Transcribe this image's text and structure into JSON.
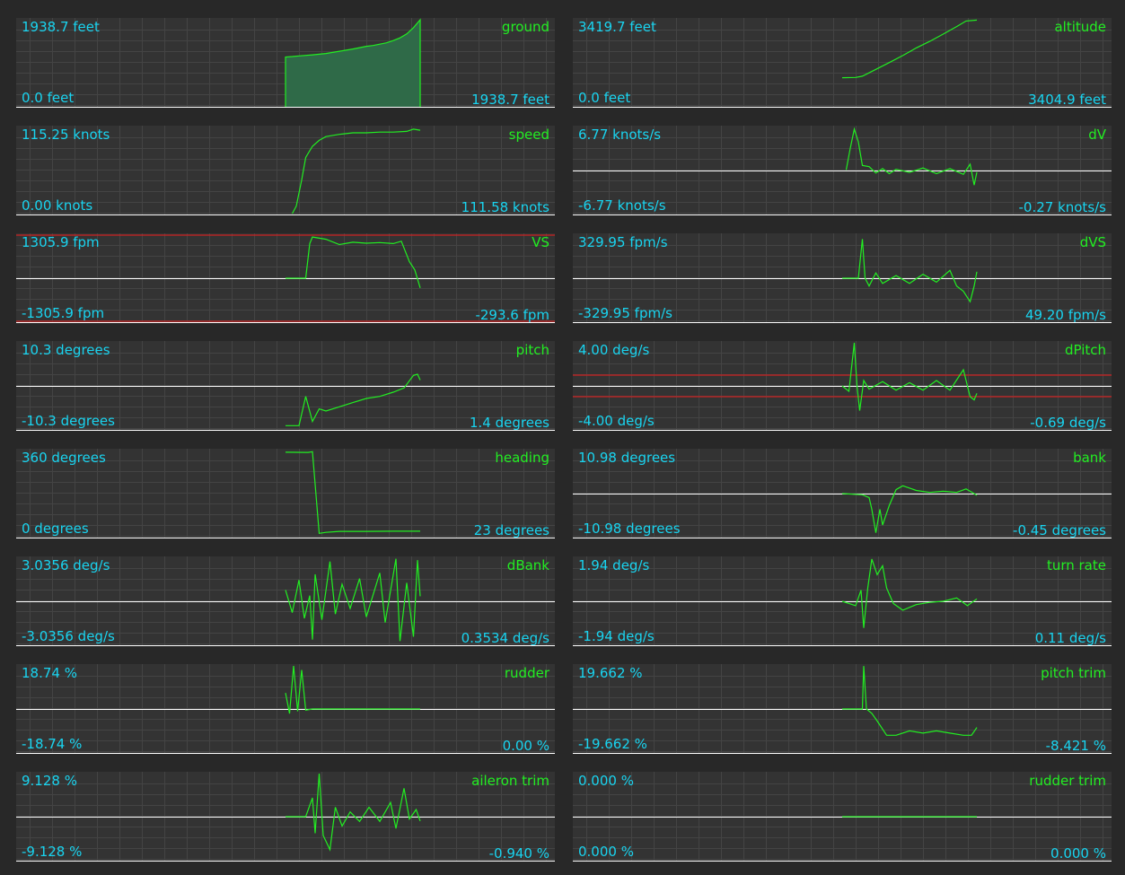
{
  "colors": {
    "grid": "#444444",
    "trace": "#22ee22",
    "value_text": "#19d4f0",
    "name_text": "#22ee22",
    "limit_line": "#cc2222",
    "axis": "#ffffff"
  },
  "panels": [
    {
      "id": "ground",
      "name": "ground",
      "max_label": "1938.7 feet",
      "min_label": "0.0 feet",
      "current_label": "1938.7 feet",
      "style": "area",
      "y_range": [
        0,
        1938.7
      ],
      "zero_line": false,
      "limit_lines": [],
      "trace": [
        [
          0,
          1100
        ],
        [
          0.05,
          1110
        ],
        [
          0.1,
          1125
        ],
        [
          0.2,
          1150
        ],
        [
          0.3,
          1180
        ],
        [
          0.4,
          1230
        ],
        [
          0.5,
          1280
        ],
        [
          0.55,
          1310
        ],
        [
          0.6,
          1340
        ],
        [
          0.65,
          1360
        ],
        [
          0.7,
          1390
        ],
        [
          0.75,
          1420
        ],
        [
          0.8,
          1470
        ],
        [
          0.85,
          1530
        ],
        [
          0.9,
          1620
        ],
        [
          0.95,
          1760
        ],
        [
          1,
          1938.7
        ]
      ]
    },
    {
      "id": "altitude",
      "name": "altitude",
      "max_label": "3419.7 feet",
      "min_label": "0.0 feet",
      "current_label": "3404.9 feet",
      "style": "line",
      "y_range": [
        0,
        3419.7
      ],
      "zero_line": false,
      "limit_lines": [],
      "trace": [
        [
          0,
          1120
        ],
        [
          0.1,
          1130
        ],
        [
          0.15,
          1180
        ],
        [
          0.25,
          1450
        ],
        [
          0.35,
          1720
        ],
        [
          0.45,
          2000
        ],
        [
          0.55,
          2300
        ],
        [
          0.65,
          2560
        ],
        [
          0.75,
          2850
        ],
        [
          0.85,
          3150
        ],
        [
          0.92,
          3370
        ],
        [
          1,
          3404.9
        ]
      ]
    },
    {
      "id": "speed",
      "name": "speed",
      "max_label": "115.25 knots",
      "min_label": "0.00 knots",
      "current_label": "111.58 knots",
      "style": "line",
      "y_range": [
        0,
        115.25
      ],
      "zero_line": false,
      "limit_lines": [],
      "trace": [
        [
          0.05,
          0
        ],
        [
          0.08,
          10
        ],
        [
          0.12,
          45
        ],
        [
          0.15,
          75
        ],
        [
          0.2,
          90
        ],
        [
          0.25,
          98
        ],
        [
          0.3,
          103
        ],
        [
          0.4,
          106
        ],
        [
          0.5,
          108
        ],
        [
          0.6,
          108
        ],
        [
          0.7,
          109
        ],
        [
          0.8,
          109
        ],
        [
          0.9,
          110
        ],
        [
          0.95,
          113
        ],
        [
          1,
          111.58
        ]
      ]
    },
    {
      "id": "dv",
      "name": "dV",
      "max_label": "6.77 knots/s",
      "min_label": "-6.77 knots/s",
      "current_label": "-0.27 knots/s",
      "style": "line",
      "y_range": [
        -6.77,
        6.77
      ],
      "zero_line": true,
      "limit_lines": [],
      "trace": [
        [
          0.03,
          0.1
        ],
        [
          0.06,
          3.5
        ],
        [
          0.09,
          6.5
        ],
        [
          0.12,
          4.5
        ],
        [
          0.15,
          0.8
        ],
        [
          0.2,
          0.6
        ],
        [
          0.25,
          -0.4
        ],
        [
          0.3,
          0.3
        ],
        [
          0.35,
          -0.5
        ],
        [
          0.4,
          0.2
        ],
        [
          0.5,
          -0.3
        ],
        [
          0.6,
          0.4
        ],
        [
          0.7,
          -0.5
        ],
        [
          0.8,
          0.3
        ],
        [
          0.9,
          -0.6
        ],
        [
          0.95,
          1.0
        ],
        [
          0.98,
          -2.3
        ],
        [
          1,
          -0.27
        ]
      ]
    },
    {
      "id": "vs",
      "name": "VS",
      "max_label": "1305.9 fpm",
      "min_label": "-1305.9 fpm",
      "current_label": "-293.6 fpm",
      "style": "line",
      "y_range": [
        -1305.9,
        1305.9
      ],
      "zero_line": true,
      "limit_lines": [
        1305.9,
        -1305.9
      ],
      "trace": [
        [
          0,
          0
        ],
        [
          0.15,
          0
        ],
        [
          0.18,
          1050
        ],
        [
          0.2,
          1250
        ],
        [
          0.3,
          1180
        ],
        [
          0.4,
          1020
        ],
        [
          0.5,
          1090
        ],
        [
          0.6,
          1060
        ],
        [
          0.7,
          1080
        ],
        [
          0.8,
          1050
        ],
        [
          0.86,
          1120
        ],
        [
          0.92,
          500
        ],
        [
          0.96,
          250
        ],
        [
          1,
          -293.6
        ]
      ]
    },
    {
      "id": "dvs",
      "name": "dVS",
      "max_label": "329.95 fpm/s",
      "min_label": "-329.95 fpm/s",
      "current_label": "49.20 fpm/s",
      "style": "line",
      "y_range": [
        -329.95,
        329.95
      ],
      "zero_line": true,
      "limit_lines": [],
      "trace": [
        [
          0,
          0
        ],
        [
          0.12,
          0
        ],
        [
          0.15,
          300
        ],
        [
          0.17,
          0
        ],
        [
          0.2,
          -60
        ],
        [
          0.25,
          40
        ],
        [
          0.3,
          -40
        ],
        [
          0.4,
          20
        ],
        [
          0.5,
          -40
        ],
        [
          0.6,
          30
        ],
        [
          0.7,
          -30
        ],
        [
          0.8,
          60
        ],
        [
          0.85,
          -60
        ],
        [
          0.9,
          -100
        ],
        [
          0.95,
          -180
        ],
        [
          0.98,
          -60
        ],
        [
          1,
          49.2
        ]
      ]
    },
    {
      "id": "pitch",
      "name": "pitch",
      "max_label": "10.3 degrees",
      "min_label": "-10.3 degrees",
      "current_label": "1.4 degrees",
      "style": "line",
      "y_range": [
        -10.3,
        10.3
      ],
      "zero_line": true,
      "limit_lines": [],
      "trace": [
        [
          0,
          -9.5
        ],
        [
          0.1,
          -9.5
        ],
        [
          0.15,
          -2.5
        ],
        [
          0.2,
          -8.5
        ],
        [
          0.25,
          -5.5
        ],
        [
          0.3,
          -6
        ],
        [
          0.4,
          -5
        ],
        [
          0.5,
          -4
        ],
        [
          0.6,
          -3
        ],
        [
          0.7,
          -2.5
        ],
        [
          0.8,
          -1.5
        ],
        [
          0.88,
          -0.5
        ],
        [
          0.95,
          2.5
        ],
        [
          0.98,
          2.8
        ],
        [
          1,
          1.4
        ]
      ]
    },
    {
      "id": "dpitch",
      "name": "dPitch",
      "max_label": "4.00 deg/s",
      "min_label": "-4.00 deg/s",
      "current_label": "-0.69 deg/s",
      "style": "line",
      "y_range": [
        -4.0,
        4.0
      ],
      "zero_line": true,
      "limit_lines": [
        1.0,
        -1.0
      ],
      "trace": [
        [
          0,
          0
        ],
        [
          0.05,
          -0.5
        ],
        [
          0.09,
          4.0
        ],
        [
          0.11,
          0
        ],
        [
          0.13,
          -2.3
        ],
        [
          0.16,
          0.5
        ],
        [
          0.2,
          -0.3
        ],
        [
          0.3,
          0.4
        ],
        [
          0.4,
          -0.4
        ],
        [
          0.5,
          0.3
        ],
        [
          0.6,
          -0.4
        ],
        [
          0.7,
          0.5
        ],
        [
          0.8,
          -0.4
        ],
        [
          0.9,
          1.5
        ],
        [
          0.95,
          -1.0
        ],
        [
          0.98,
          -1.3
        ],
        [
          1,
          -0.69
        ]
      ]
    },
    {
      "id": "heading",
      "name": "heading",
      "max_label": "360 degrees",
      "min_label": "0 degrees",
      "current_label": "23 degrees",
      "style": "line",
      "y_range": [
        0,
        360
      ],
      "zero_line": false,
      "limit_lines": [],
      "trace": [
        [
          0,
          353
        ],
        [
          0.15,
          352
        ],
        [
          0.17,
          352
        ],
        [
          0.2,
          355
        ],
        [
          0.25,
          14
        ],
        [
          0.3,
          18
        ],
        [
          0.4,
          22
        ],
        [
          0.6,
          22
        ],
        [
          0.8,
          23
        ],
        [
          1,
          23
        ]
      ]
    },
    {
      "id": "bank",
      "name": "bank",
      "max_label": "10.98 degrees",
      "min_label": "-10.98 degrees",
      "current_label": "-0.45 degrees",
      "style": "line",
      "y_range": [
        -10.98,
        10.98
      ],
      "zero_line": true,
      "limit_lines": [],
      "trace": [
        [
          0,
          0
        ],
        [
          0.15,
          -0.3
        ],
        [
          0.2,
          -1
        ],
        [
          0.22,
          -4
        ],
        [
          0.25,
          -10
        ],
        [
          0.28,
          -4
        ],
        [
          0.3,
          -8
        ],
        [
          0.35,
          -3
        ],
        [
          0.4,
          1
        ],
        [
          0.45,
          2
        ],
        [
          0.55,
          0.8
        ],
        [
          0.65,
          0.3
        ],
        [
          0.75,
          0.6
        ],
        [
          0.85,
          0.3
        ],
        [
          0.92,
          1.2
        ],
        [
          0.97,
          0.2
        ],
        [
          1,
          -0.45
        ]
      ]
    },
    {
      "id": "dbank",
      "name": "dBank",
      "max_label": "3.0356 deg/s",
      "min_label": "-3.0356 deg/s",
      "current_label": "0.3534 deg/s",
      "style": "line",
      "y_range": [
        -3.0356,
        3.0356
      ],
      "zero_line": true,
      "limit_lines": [],
      "trace": [
        [
          0,
          0.8
        ],
        [
          0.05,
          -0.8
        ],
        [
          0.1,
          1.5
        ],
        [
          0.14,
          -1.2
        ],
        [
          0.18,
          0.4
        ],
        [
          0.2,
          -2.7
        ],
        [
          0.22,
          1.9
        ],
        [
          0.27,
          -1.3
        ],
        [
          0.33,
          2.8
        ],
        [
          0.37,
          -0.9
        ],
        [
          0.42,
          1.2
        ],
        [
          0.48,
          -0.5
        ],
        [
          0.55,
          1.6
        ],
        [
          0.6,
          -1.1
        ],
        [
          0.7,
          2.0
        ],
        [
          0.74,
          -1.5
        ],
        [
          0.82,
          3.0
        ],
        [
          0.85,
          -2.8
        ],
        [
          0.9,
          1.3
        ],
        [
          0.95,
          -2.5
        ],
        [
          0.98,
          2.9
        ],
        [
          1,
          0.3534
        ]
      ]
    },
    {
      "id": "turnrate",
      "name": "turn rate",
      "max_label": "1.94 deg/s",
      "min_label": "-1.94 deg/s",
      "current_label": "0.11 deg/s",
      "style": "line",
      "y_range": [
        -1.94,
        1.94
      ],
      "zero_line": true,
      "limit_lines": [],
      "trace": [
        [
          0,
          0
        ],
        [
          0.1,
          -0.2
        ],
        [
          0.14,
          0.5
        ],
        [
          0.16,
          -1.2
        ],
        [
          0.19,
          0.6
        ],
        [
          0.22,
          1.9
        ],
        [
          0.26,
          1.2
        ],
        [
          0.3,
          1.6
        ],
        [
          0.33,
          0.6
        ],
        [
          0.38,
          -0.1
        ],
        [
          0.45,
          -0.4
        ],
        [
          0.55,
          -0.15
        ],
        [
          0.65,
          -0.05
        ],
        [
          0.75,
          0
        ],
        [
          0.85,
          0.15
        ],
        [
          0.93,
          -0.2
        ],
        [
          1,
          0.11
        ]
      ]
    },
    {
      "id": "rudder",
      "name": "rudder",
      "max_label": "18.74 %",
      "min_label": "-18.74 %",
      "current_label": "0.00 %",
      "style": "line",
      "y_range": [
        -18.74,
        18.74
      ],
      "zero_line": true,
      "limit_lines": [],
      "trace": [
        [
          0,
          7
        ],
        [
          0.03,
          -2
        ],
        [
          0.06,
          18.7
        ],
        [
          0.09,
          -1
        ],
        [
          0.12,
          17
        ],
        [
          0.15,
          -0.5
        ],
        [
          0.18,
          -0.2
        ],
        [
          0.2,
          0
        ],
        [
          1,
          0
        ]
      ]
    },
    {
      "id": "pitchtrim",
      "name": "pitch trim",
      "max_label": "19.662 %",
      "min_label": "-19.662 %",
      "current_label": "-8.421 %",
      "style": "line",
      "y_range": [
        -19.662,
        19.662
      ],
      "zero_line": true,
      "limit_lines": [],
      "trace": [
        [
          0,
          0
        ],
        [
          0.15,
          0
        ],
        [
          0.16,
          19.6
        ],
        [
          0.18,
          0
        ],
        [
          0.22,
          -2
        ],
        [
          0.26,
          -5.5
        ],
        [
          0.33,
          -12
        ],
        [
          0.4,
          -12
        ],
        [
          0.5,
          -10
        ],
        [
          0.6,
          -11
        ],
        [
          0.7,
          -10
        ],
        [
          0.8,
          -11
        ],
        [
          0.9,
          -12
        ],
        [
          0.96,
          -12
        ],
        [
          1,
          -8.421
        ]
      ]
    },
    {
      "id": "ailerontrim",
      "name": "aileron trim",
      "max_label": "9.128 %",
      "min_label": "-9.128 %",
      "current_label": "-0.940 %",
      "style": "line",
      "y_range": [
        -9.128,
        9.128
      ],
      "zero_line": true,
      "limit_lines": [],
      "trace": [
        [
          0,
          0
        ],
        [
          0.15,
          0
        ],
        [
          0.2,
          4
        ],
        [
          0.22,
          -3.5
        ],
        [
          0.25,
          9.1
        ],
        [
          0.28,
          -4
        ],
        [
          0.33,
          -7
        ],
        [
          0.37,
          2
        ],
        [
          0.42,
          -2
        ],
        [
          0.48,
          1
        ],
        [
          0.55,
          -1
        ],
        [
          0.62,
          2
        ],
        [
          0.7,
          -1
        ],
        [
          0.78,
          3
        ],
        [
          0.82,
          -2.5
        ],
        [
          0.88,
          6
        ],
        [
          0.92,
          -0.5
        ],
        [
          0.97,
          1.5
        ],
        [
          1,
          -0.94
        ]
      ]
    },
    {
      "id": "ruddertrim",
      "name": "rudder trim",
      "max_label": "0.000 %",
      "min_label": "0.000 %",
      "current_label": "0.000 %",
      "style": "line",
      "y_range": [
        -1,
        1
      ],
      "zero_line": true,
      "limit_lines": [],
      "trace": [
        [
          0,
          0
        ],
        [
          1,
          0
        ]
      ]
    }
  ],
  "chart_data": [
    {
      "type": "area",
      "title": "ground",
      "ylim": [
        0,
        1938.7
      ],
      "ylabel": "feet",
      "current": 1938.7
    },
    {
      "type": "line",
      "title": "altitude",
      "ylim": [
        0,
        3419.7
      ],
      "ylabel": "feet",
      "current": 3404.9
    },
    {
      "type": "line",
      "title": "speed",
      "ylim": [
        0,
        115.25
      ],
      "ylabel": "knots",
      "current": 111.58
    },
    {
      "type": "line",
      "title": "dV",
      "ylim": [
        -6.77,
        6.77
      ],
      "ylabel": "knots/s",
      "current": -0.27
    },
    {
      "type": "line",
      "title": "VS",
      "ylim": [
        -1305.9,
        1305.9
      ],
      "ylabel": "fpm",
      "current": -293.6
    },
    {
      "type": "line",
      "title": "dVS",
      "ylim": [
        -329.95,
        329.95
      ],
      "ylabel": "fpm/s",
      "current": 49.2
    },
    {
      "type": "line",
      "title": "pitch",
      "ylim": [
        -10.3,
        10.3
      ],
      "ylabel": "degrees",
      "current": 1.4
    },
    {
      "type": "line",
      "title": "dPitch",
      "ylim": [
        -4.0,
        4.0
      ],
      "ylabel": "deg/s",
      "current": -0.69
    },
    {
      "type": "line",
      "title": "heading",
      "ylim": [
        0,
        360
      ],
      "ylabel": "degrees",
      "current": 23
    },
    {
      "type": "line",
      "title": "bank",
      "ylim": [
        -10.98,
        10.98
      ],
      "ylabel": "degrees",
      "current": -0.45
    },
    {
      "type": "line",
      "title": "dBank",
      "ylim": [
        -3.0356,
        3.0356
      ],
      "ylabel": "deg/s",
      "current": 0.3534
    },
    {
      "type": "line",
      "title": "turn rate",
      "ylim": [
        -1.94,
        1.94
      ],
      "ylabel": "deg/s",
      "current": 0.11
    },
    {
      "type": "line",
      "title": "rudder",
      "ylim": [
        -18.74,
        18.74
      ],
      "ylabel": "%",
      "current": 0.0
    },
    {
      "type": "line",
      "title": "pitch trim",
      "ylim": [
        -19.662,
        19.662
      ],
      "ylabel": "%",
      "current": -8.421
    },
    {
      "type": "line",
      "title": "aileron trim",
      "ylim": [
        -9.128,
        9.128
      ],
      "ylabel": "%",
      "current": -0.94
    },
    {
      "type": "line",
      "title": "rudder trim",
      "ylim": [
        0.0,
        0.0
      ],
      "ylabel": "%",
      "current": 0.0
    }
  ]
}
